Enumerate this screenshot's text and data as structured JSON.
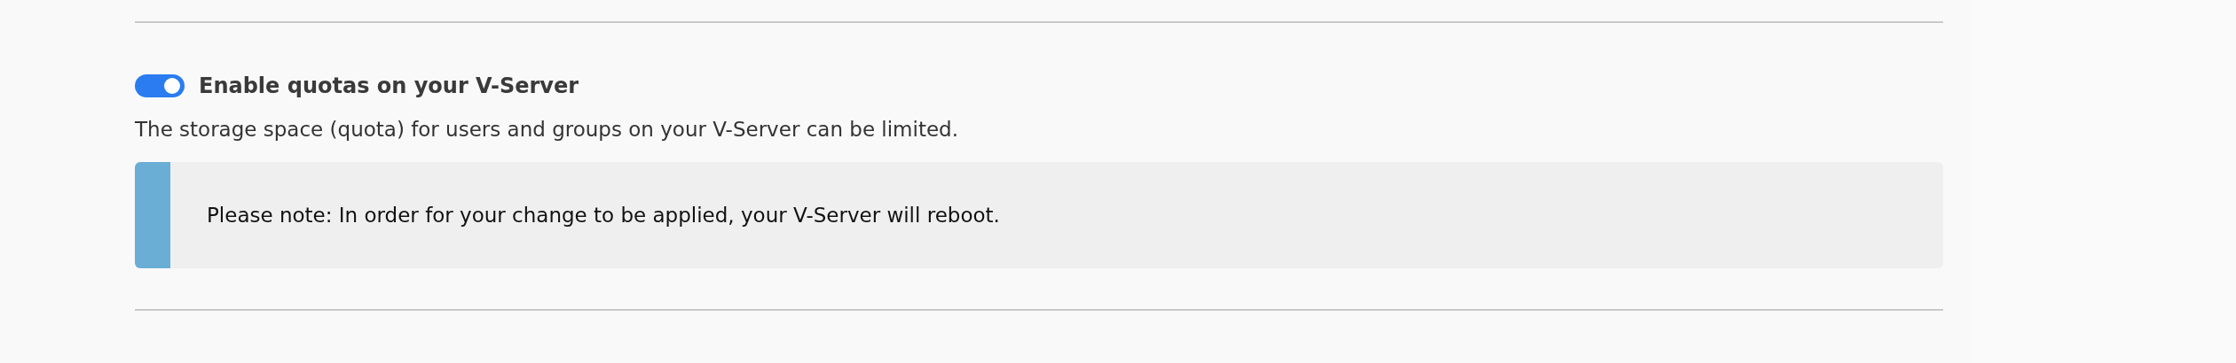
{
  "setting": {
    "title": "Enable quotas on your V-Server",
    "on": true,
    "description": "The storage space (quota) for users and groups on your V-Server can be limited.",
    "note": "Please note: In order for your change to be applied, your V-Server will reboot."
  }
}
